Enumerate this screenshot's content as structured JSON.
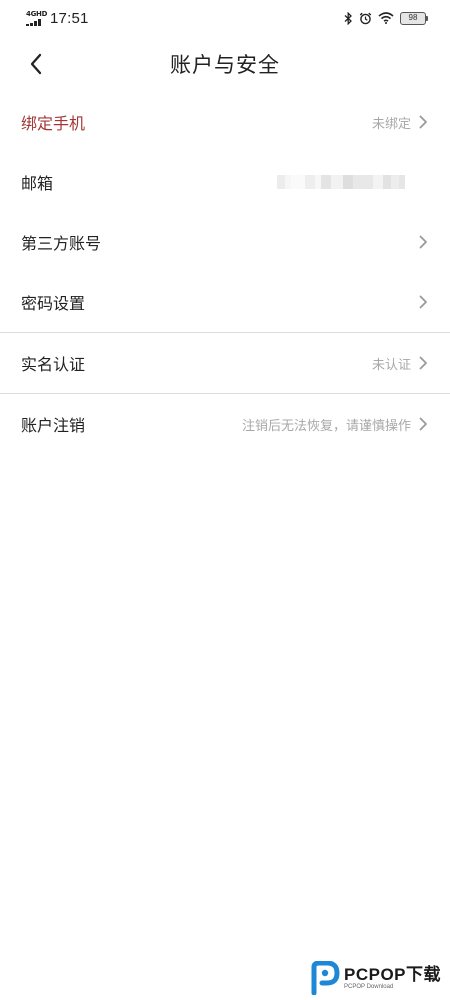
{
  "status_bar": {
    "network": "4GHD",
    "time": "17:51",
    "battery": "98"
  },
  "header": {
    "title": "账户与安全"
  },
  "settings": [
    {
      "label": "绑定手机",
      "value": "未绑定",
      "highlight": true
    },
    {
      "label": "邮箱",
      "value": ""
    },
    {
      "label": "第三方账号",
      "value": ""
    },
    {
      "label": "密码设置",
      "value": ""
    },
    {
      "label": "实名认证",
      "value": "未认证"
    },
    {
      "label": "账户注销",
      "value": "注销后无法恢复，请谨慎操作"
    }
  ],
  "colors": {
    "highlight_label": "#a33636",
    "secondary_text": "#a8a8a8",
    "divider": "#dcdcdc"
  },
  "watermark": {
    "name": "PCPOP下载",
    "sub": "PCPOP Download"
  }
}
